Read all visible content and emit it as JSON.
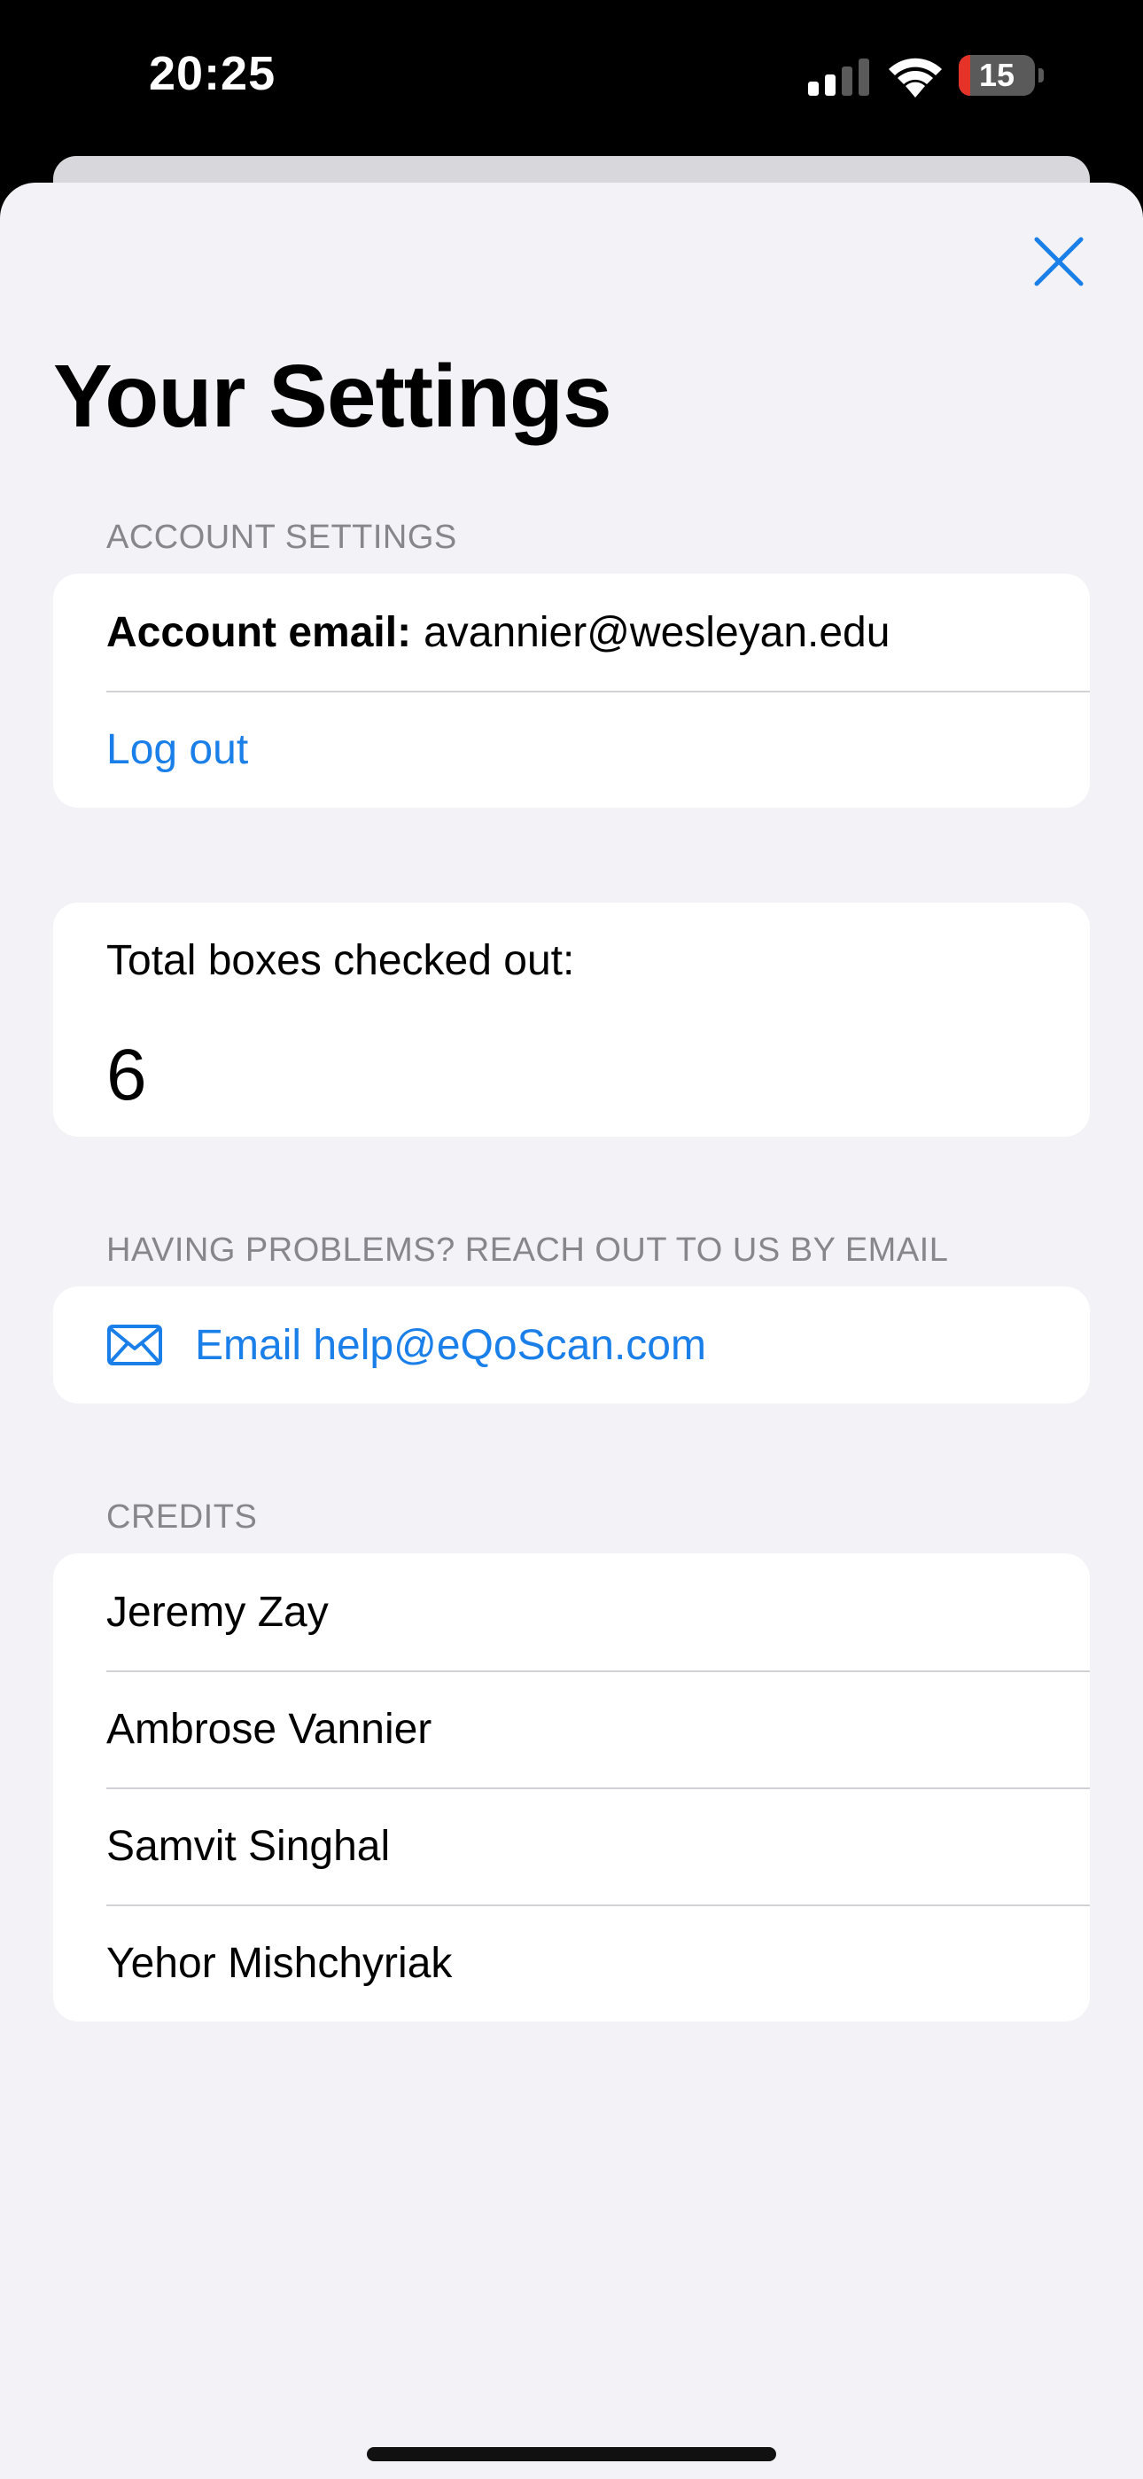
{
  "status_bar": {
    "time": "20:25",
    "battery_level": "15",
    "battery_fraction": 0.15,
    "icons": [
      "signal-icon",
      "wifi-icon",
      "battery-icon"
    ]
  },
  "header": {
    "title": "Your Settings",
    "close_icon": "close-icon"
  },
  "account_section": {
    "header": "ACCOUNT SETTINGS",
    "email_label": "Account email:",
    "email_value": "avannier@wesleyan.edu",
    "logout_label": "Log out"
  },
  "checkout_section": {
    "label": "Total boxes checked out:",
    "count": "6"
  },
  "help_section": {
    "header": "HAVING PROBLEMS? REACH OUT TO US BY EMAIL",
    "email_link": "Email help@eQoScan.com",
    "icon": "envelope-icon"
  },
  "credits_section": {
    "header": "CREDITS",
    "names": [
      "Jeremy Zay",
      "Ambrose Vannier",
      "Samvit Singhal",
      "Yehor Mishchyriak"
    ]
  },
  "colors": {
    "accent": "#1a7fe8",
    "background": "#f2f2f7",
    "card": "#ffffff",
    "section_header": "#86868b",
    "battery_low": "#e5332a"
  }
}
